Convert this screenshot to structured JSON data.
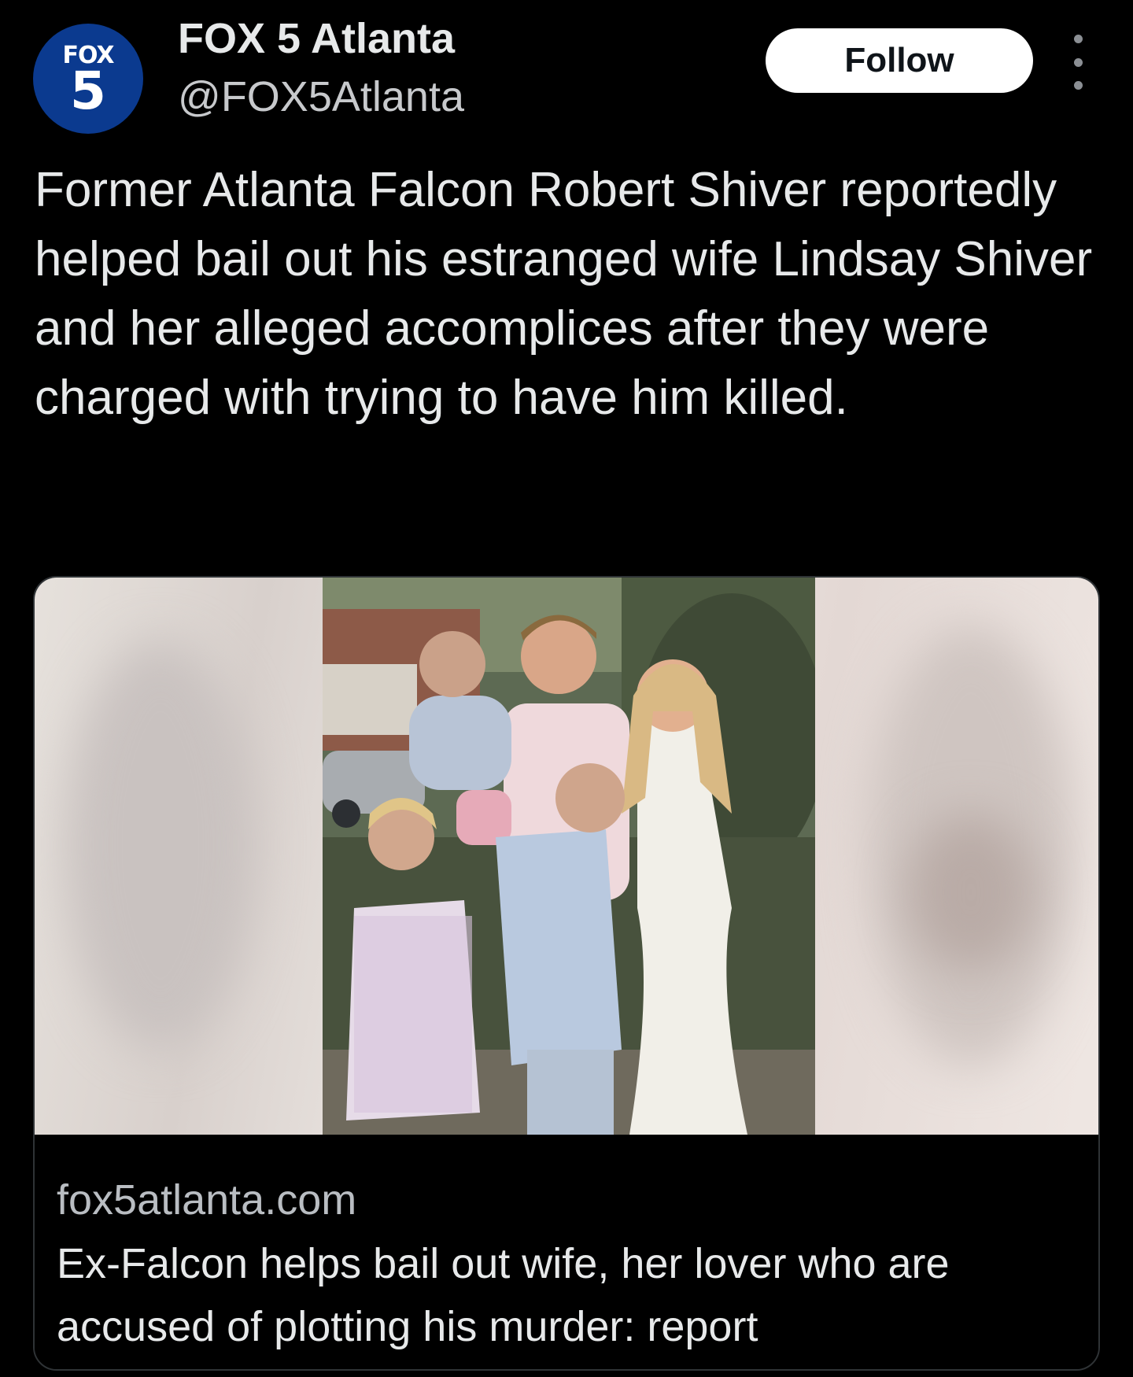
{
  "account": {
    "display_name": "FOX 5 Atlanta",
    "handle": "@FOX5Atlanta",
    "avatar_logo_word": "FOX",
    "avatar_logo_number": "5",
    "avatar_color": "#0b3a8f"
  },
  "actions": {
    "follow_label": "Follow",
    "more_icon": "more-vertical-icon"
  },
  "tweet": {
    "text": "Former Atlanta Falcon Robert Shiver reportedly helped bail out his estranged wife Lindsay Shiver and her alleged accomplices after they were charged with trying to have him killed."
  },
  "link_card": {
    "domain": "fox5atlanta.com",
    "title": "Ex-Falcon helps bail out wife, her lover who are accused of plotting his murder: report"
  },
  "colors": {
    "background": "#000000",
    "text_primary": "#e7e9ea",
    "text_secondary": "#b9bdc2",
    "follow_button_bg": "#ffffff"
  }
}
